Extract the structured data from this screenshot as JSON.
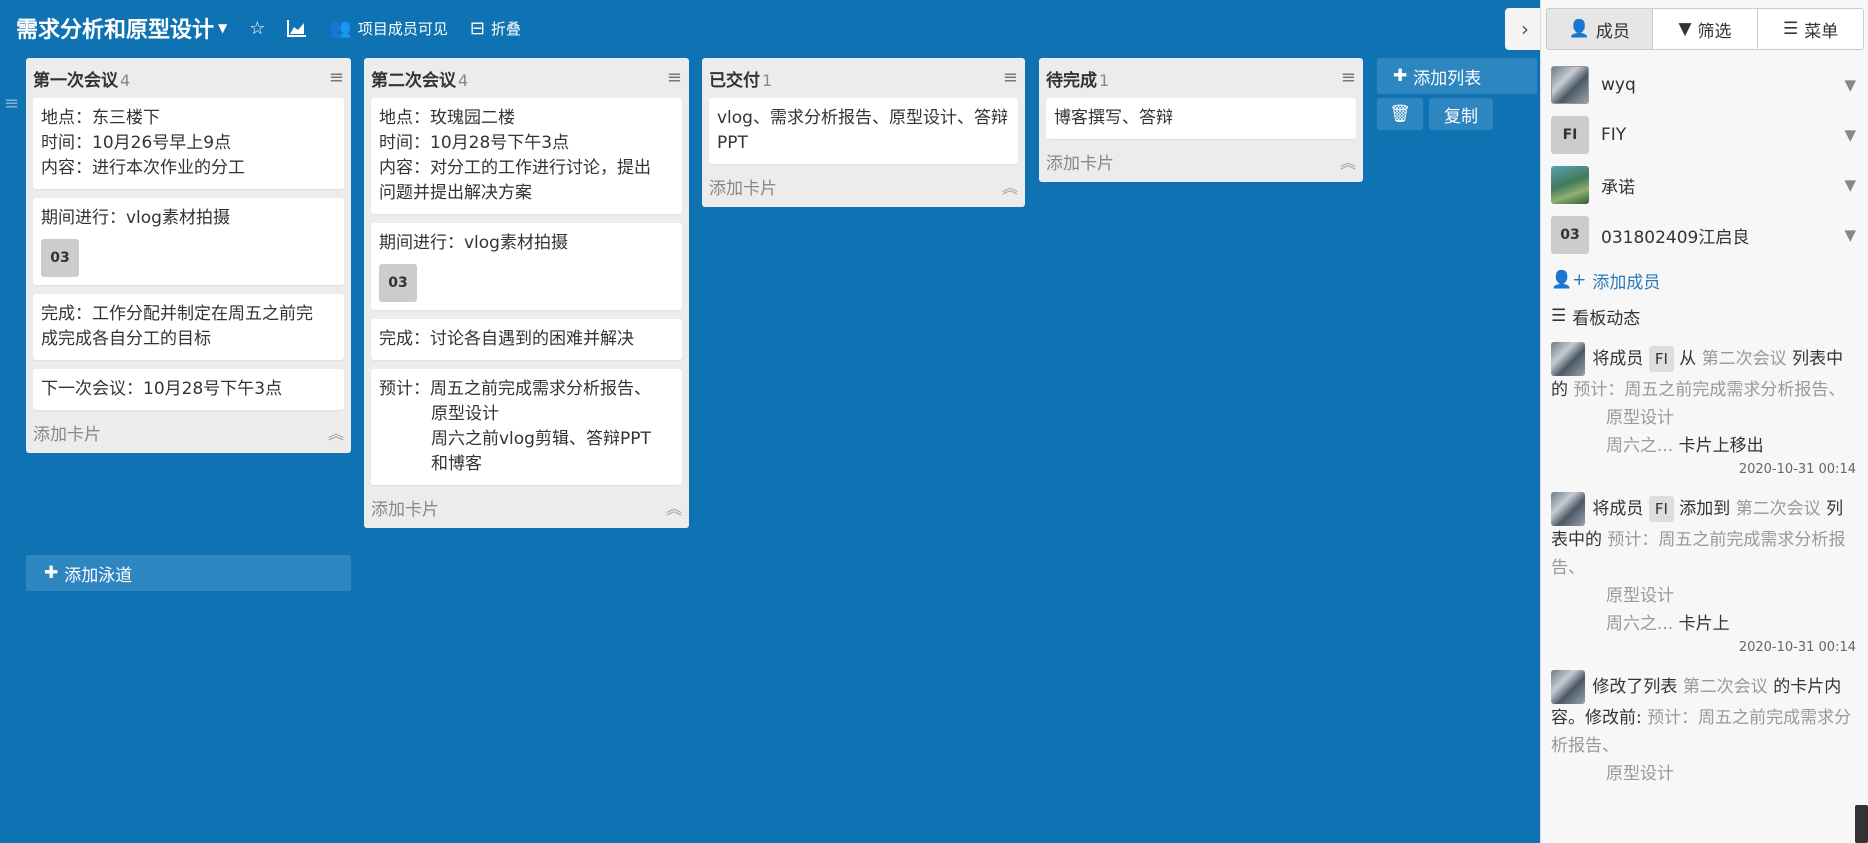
{
  "header": {
    "title": "需求分析和原型设计",
    "visibility": "项目成员可见",
    "collapse": "折叠"
  },
  "lists": [
    {
      "title": "第一次会议",
      "count": "4",
      "cards": [
        {
          "lines": [
            "地点：东三楼下",
            "时间：10月26号早上9点",
            "内容：进行本次作业的分工"
          ]
        },
        {
          "lines": [
            "期间进行：vlog素材拍摄"
          ],
          "badge": "03"
        },
        {
          "lines": [
            "完成：工作分配并制定在周五之前完",
            "成完成各自分工的目标"
          ]
        },
        {
          "lines": [
            "下一次会议：10月28号下午3点"
          ]
        }
      ],
      "add_card": "添加卡片"
    },
    {
      "title": "第二次会议",
      "count": "4",
      "cards": [
        {
          "lines": [
            "地点：玫瑰园二楼",
            "时间：10月28号下午3点",
            "内容：对分工的工作进行讨论，提出",
            "问题并提出解决方案"
          ]
        },
        {
          "lines": [
            "期间进行：vlog素材拍摄"
          ],
          "badge": "03"
        },
        {
          "lines": [
            "完成：讨论各自遇到的困难并解决"
          ]
        },
        {
          "lines": [
            "预计：周五之前完成需求分析报告、"
          ],
          "indent": [
            "原型设计",
            "周六之前vlog剪辑、答辩PPT",
            "和博客"
          ]
        }
      ],
      "add_card": "添加卡片"
    },
    {
      "title": "已交付",
      "count": "1",
      "cards": [
        {
          "lines": [
            "vlog、需求分析报告、原型设计、答辩",
            "PPT"
          ]
        }
      ],
      "add_card": "添加卡片"
    },
    {
      "title": "待完成",
      "count": "1",
      "cards": [
        {
          "lines": [
            "博客撰写、答辩"
          ]
        }
      ],
      "add_card": "添加卡片"
    }
  ],
  "add_list": "添加列表",
  "copy": "复制",
  "add_swimlane": "添加泳道",
  "sidebar": {
    "tabs": [
      "成员",
      "筛选",
      "菜单"
    ],
    "members": [
      {
        "name": "wyq",
        "avatar": "photo1"
      },
      {
        "name": "FIY",
        "avatar": "FI"
      },
      {
        "name": "承诺",
        "avatar": "photo2"
      },
      {
        "name": "031802409江启良",
        "avatar": "03"
      }
    ],
    "add_member": "添加成员",
    "activity_title": "看板动态",
    "activities": [
      {
        "a": "将成员",
        "chip": "FI",
        "b": "从",
        "list": "第二次会议",
        "c": "列表中的",
        "d": "预计：周五之前完成需求分析报告、",
        "sub1": "原型设计",
        "sub2a": "周六之...",
        "sub2b": "卡片上移出",
        "time": "2020-10-31 00:14"
      },
      {
        "a": "将成员",
        "chip": "FI",
        "b": "添加到",
        "list": "第二次会议",
        "c": "列表中的",
        "d": "预计：周五之前完成需求分析报告、",
        "sub1": "原型设计",
        "sub2a": "周六之...",
        "sub2b": "卡片上",
        "time": "2020-10-31 00:14"
      },
      {
        "a": "修改了列表",
        "list": "第二次会议",
        "b": "的卡片内容。修改前:",
        "d": "预计：周五之前完成需求分析报告、",
        "sub1": "原型设计"
      }
    ]
  }
}
